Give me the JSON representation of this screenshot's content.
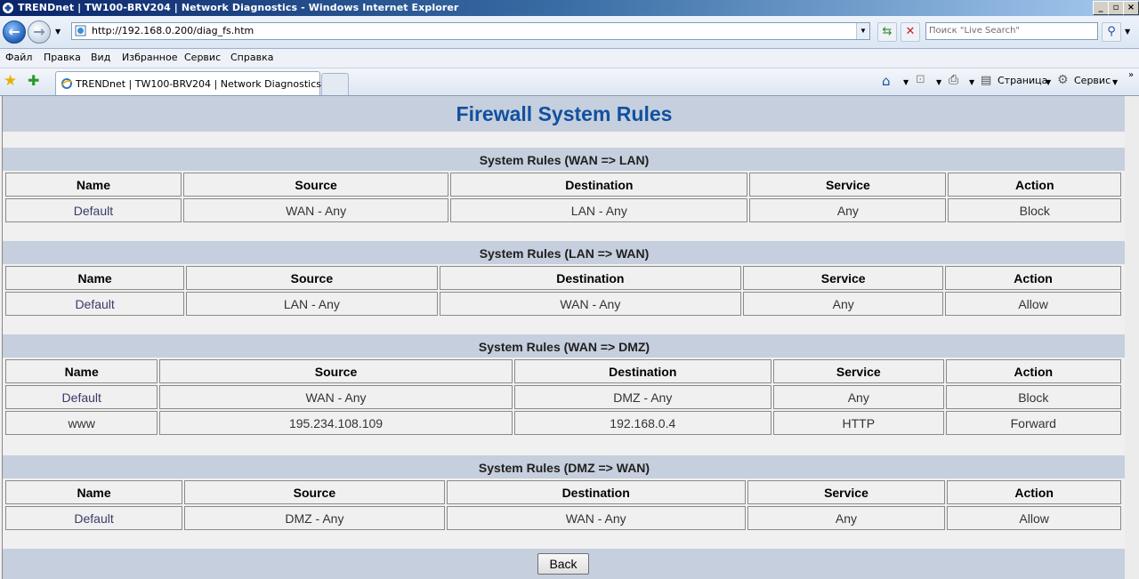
{
  "window": {
    "title": "TRENDnet | TW100-BRV204 | Network Diagnostics - Windows Internet Explorer"
  },
  "address": {
    "url": "http://192.168.0.200/diag_fs.htm"
  },
  "search": {
    "placeholder": "Поиск \"Live Search\""
  },
  "menu": {
    "file": "Файл",
    "edit": "Правка",
    "view": "Вид",
    "favorites": "Избранное",
    "tools": "Сервис",
    "help": "Справка"
  },
  "tab": {
    "title": "TRENDnet | TW100-BRV204 | Network Diagnostics"
  },
  "commandbar": {
    "page": "Страница",
    "tools": "Сервис"
  },
  "page": {
    "title": "Firewall System Rules",
    "headers": {
      "name": "Name",
      "source": "Source",
      "destination": "Destination",
      "service": "Service",
      "action": "Action"
    },
    "sections": [
      {
        "title": "System Rules (WAN => LAN)",
        "rows": [
          {
            "name": "Default",
            "source": "WAN - Any",
            "destination": "LAN - Any",
            "service": "Any",
            "action": "Block"
          }
        ]
      },
      {
        "title": "System Rules (LAN => WAN)",
        "rows": [
          {
            "name": "Default",
            "source": "LAN - Any",
            "destination": "WAN - Any",
            "service": "Any",
            "action": "Allow"
          }
        ]
      },
      {
        "title": "System Rules (WAN => DMZ)",
        "rows": [
          {
            "name": "Default",
            "source": "WAN - Any",
            "destination": "DMZ - Any",
            "service": "Any",
            "action": "Block"
          },
          {
            "name": "www",
            "source": "195.234.108.109",
            "destination": "192.168.0.4",
            "service": "HTTP",
            "action": "Forward"
          }
        ]
      },
      {
        "title": "System Rules (DMZ => WAN)",
        "rows": [
          {
            "name": "Default",
            "source": "DMZ - Any",
            "destination": "WAN - Any",
            "service": "Any",
            "action": "Allow"
          }
        ]
      }
    ],
    "back_label": "Back"
  },
  "colors": {
    "title": "#1150a0",
    "band": "#c6cfdd",
    "background": "#f0f0f0"
  }
}
